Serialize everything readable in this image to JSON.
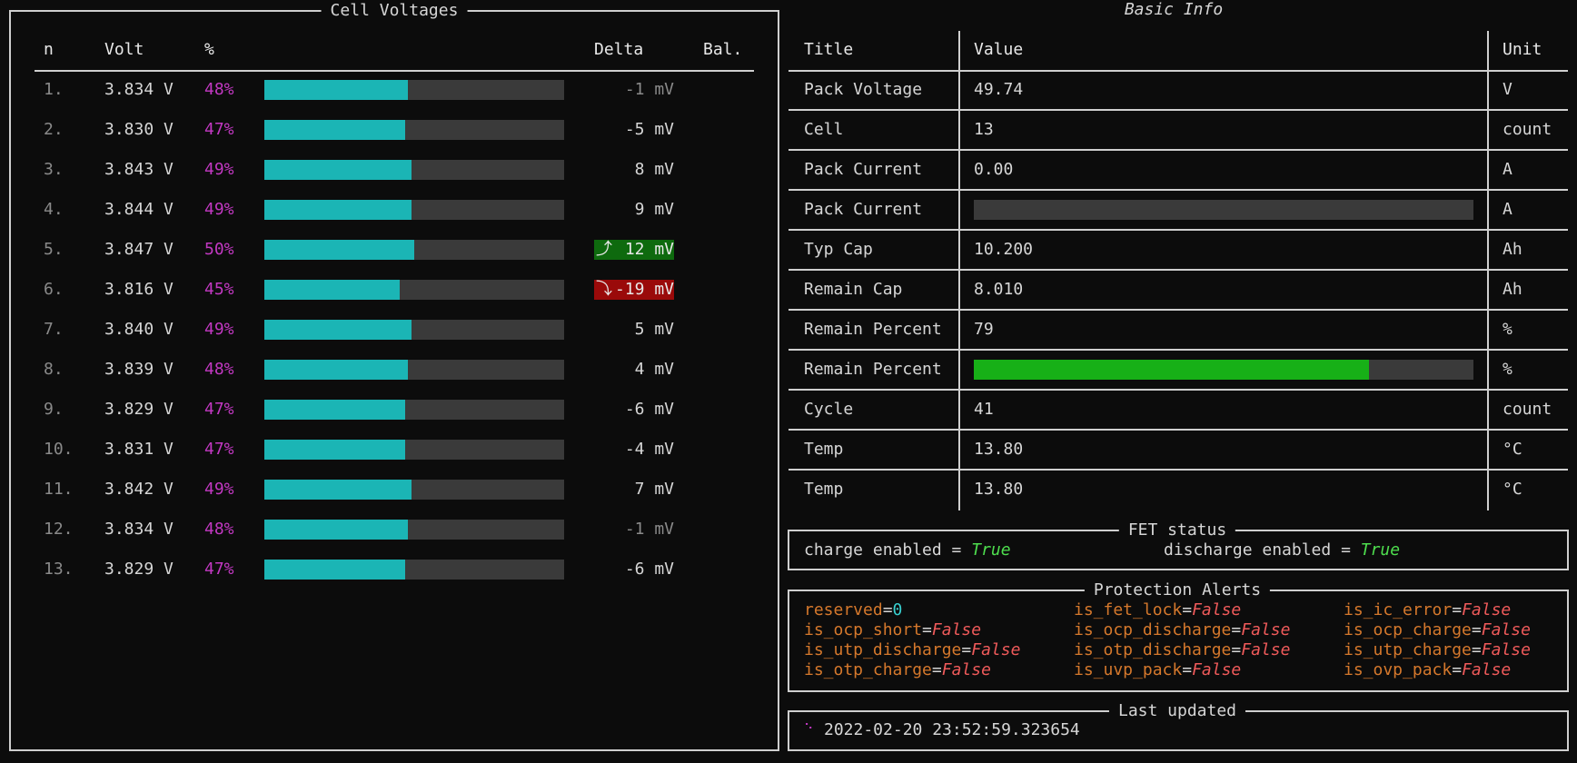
{
  "cell_panel": {
    "title": "Cell Voltages",
    "headers": {
      "n": "n",
      "volt": "Volt",
      "pct": "%",
      "delta": "Delta",
      "bal": "Bal."
    },
    "rows": [
      {
        "n": "1.",
        "volt": "3.834 V",
        "pct": "48%",
        "level": 0.48,
        "delta": "-1 mV",
        "state": "dim"
      },
      {
        "n": "2.",
        "volt": "3.830 V",
        "pct": "47%",
        "level": 0.47,
        "delta": "-5 mV",
        "state": "normal"
      },
      {
        "n": "3.",
        "volt": "3.843 V",
        "pct": "49%",
        "level": 0.49,
        "delta": "8 mV",
        "state": "normal"
      },
      {
        "n": "4.",
        "volt": "3.844 V",
        "pct": "49%",
        "level": 0.49,
        "delta": "9 mV",
        "state": "normal"
      },
      {
        "n": "5.",
        "volt": "3.847 V",
        "pct": "50%",
        "level": 0.5,
        "delta": "12 mV",
        "state": "up",
        "arrow": "⤴"
      },
      {
        "n": "6.",
        "volt": "3.816 V",
        "pct": "45%",
        "level": 0.45,
        "delta": "-19 mV",
        "state": "down",
        "arrow": "⤵"
      },
      {
        "n": "7.",
        "volt": "3.840 V",
        "pct": "49%",
        "level": 0.49,
        "delta": "5 mV",
        "state": "normal"
      },
      {
        "n": "8.",
        "volt": "3.839 V",
        "pct": "48%",
        "level": 0.48,
        "delta": "4 mV",
        "state": "normal"
      },
      {
        "n": "9.",
        "volt": "3.829 V",
        "pct": "47%",
        "level": 0.47,
        "delta": "-6 mV",
        "state": "normal"
      },
      {
        "n": "10.",
        "volt": "3.831 V",
        "pct": "47%",
        "level": 0.47,
        "delta": "-4 mV",
        "state": "normal"
      },
      {
        "n": "11.",
        "volt": "3.842 V",
        "pct": "49%",
        "level": 0.49,
        "delta": "7 mV",
        "state": "normal"
      },
      {
        "n": "12.",
        "volt": "3.834 V",
        "pct": "48%",
        "level": 0.48,
        "delta": "-1 mV",
        "state": "dim"
      },
      {
        "n": "13.",
        "volt": "3.829 V",
        "pct": "47%",
        "level": 0.47,
        "delta": "-6 mV",
        "state": "normal"
      }
    ]
  },
  "basic_info": {
    "title": "Basic Info",
    "headers": {
      "title": "Title",
      "value": "Value",
      "unit": "Unit"
    },
    "rows": [
      {
        "title": "Pack Voltage",
        "value": "49.74",
        "unit": "V"
      },
      {
        "title": "Cell",
        "value": "13",
        "unit": "count"
      },
      {
        "title": "Pack Current",
        "value": "0.00",
        "unit": "A"
      },
      {
        "title": "Pack Current",
        "bar_level": 0.0,
        "unit": "A"
      },
      {
        "title": "Typ Cap",
        "value": "10.200",
        "unit": "Ah"
      },
      {
        "title": "Remain Cap",
        "value": "8.010",
        "unit": "Ah"
      },
      {
        "title": "Remain Percent",
        "value": "79",
        "unit": "%"
      },
      {
        "title": "Remain Percent",
        "bar_level": 0.79,
        "unit": "%"
      },
      {
        "title": "Cycle",
        "value": "41",
        "unit": "count"
      },
      {
        "title": "Temp",
        "value": "13.80",
        "unit": "°C"
      },
      {
        "title": "Temp",
        "value": "13.80",
        "unit": "°C"
      }
    ]
  },
  "fet_status": {
    "title": "FET status",
    "items": [
      {
        "label": "charge enabled",
        "op": " = ",
        "value": "True"
      },
      {
        "label": "discharge enabled",
        "op": " = ",
        "value": "True"
      }
    ]
  },
  "protection_alerts": {
    "title": "Protection Alerts",
    "items": [
      {
        "key": "reserved",
        "value": "0",
        "kind": "num"
      },
      {
        "key": "is_fet_lock",
        "value": "False",
        "kind": "bool"
      },
      {
        "key": "is_ic_error",
        "value": "False",
        "kind": "bool"
      },
      {
        "key": "is_ocp_short",
        "value": "False",
        "kind": "bool"
      },
      {
        "key": "is_ocp_discharge",
        "value": "False",
        "kind": "bool"
      },
      {
        "key": "is_ocp_charge",
        "value": "False",
        "kind": "bool"
      },
      {
        "key": "is_utp_discharge",
        "value": "False",
        "kind": "bool"
      },
      {
        "key": "is_otp_discharge",
        "value": "False",
        "kind": "bool"
      },
      {
        "key": "is_utp_charge",
        "value": "False",
        "kind": "bool"
      },
      {
        "key": "is_otp_charge",
        "value": "False",
        "kind": "bool"
      },
      {
        "key": "is_uvp_pack",
        "value": "False",
        "kind": "bool"
      },
      {
        "key": "is_ovp_pack",
        "value": "False",
        "kind": "bool"
      }
    ]
  },
  "last_updated": {
    "title": "Last updated",
    "spinner": "⠑",
    "timestamp": "2022-02-20 23:52:59.323654"
  },
  "colors": {
    "cell_bar": "#1bb5b5",
    "remain_bar": "#17b017",
    "percent_text": "#c238c2",
    "delta_up_bg": "#0e6a0e",
    "delta_down_bg": "#9a0a0a",
    "alert_key": "#d5782c",
    "false_value": "#ef5a5a",
    "true_value": "#4ede4e"
  }
}
